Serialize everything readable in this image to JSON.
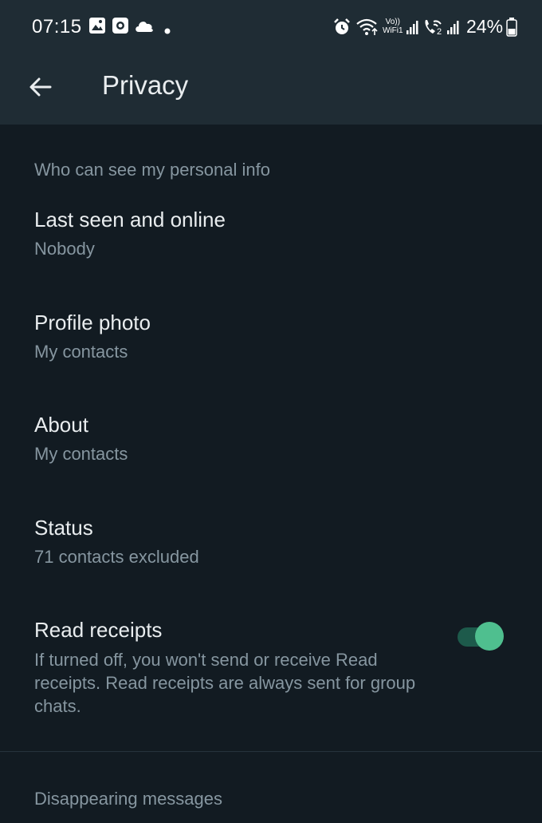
{
  "status_bar": {
    "time": "07:15",
    "battery": "24%",
    "wifi_label_top": "Vo))",
    "wifi_label_bottom": "WiFi1",
    "sim2_label": "2",
    "left_icons": [
      "gallery-icon",
      "record-icon",
      "cloud-icon",
      "dot-icon"
    ],
    "right_icons": [
      "alarm-icon",
      "wifi-icon",
      "signal-icon",
      "wifi-calling-icon",
      "signal-icon",
      "battery-icon"
    ]
  },
  "app_bar": {
    "title": "Privacy",
    "back_icon": "arrow-left-icon"
  },
  "sections": {
    "personal_info": {
      "header": "Who can see my personal info",
      "items": [
        {
          "title": "Last seen and online",
          "subtitle": "Nobody"
        },
        {
          "title": "Profile photo",
          "subtitle": "My contacts"
        },
        {
          "title": "About",
          "subtitle": "My contacts"
        },
        {
          "title": "Status",
          "subtitle": "71 contacts excluded"
        }
      ],
      "read_receipts": {
        "title": "Read receipts",
        "description": "If turned off, you won't send or receive Read receipts. Read receipts are always sent for group chats.",
        "enabled": true
      }
    },
    "disappearing": {
      "header": "Disappearing messages"
    }
  },
  "colors": {
    "background": "#121b22",
    "bar": "#1f2c34",
    "primary_text": "#e9edef",
    "secondary_text": "#8696a0",
    "accent": "#4fbf8f",
    "accent_track": "#1d5a4b"
  }
}
